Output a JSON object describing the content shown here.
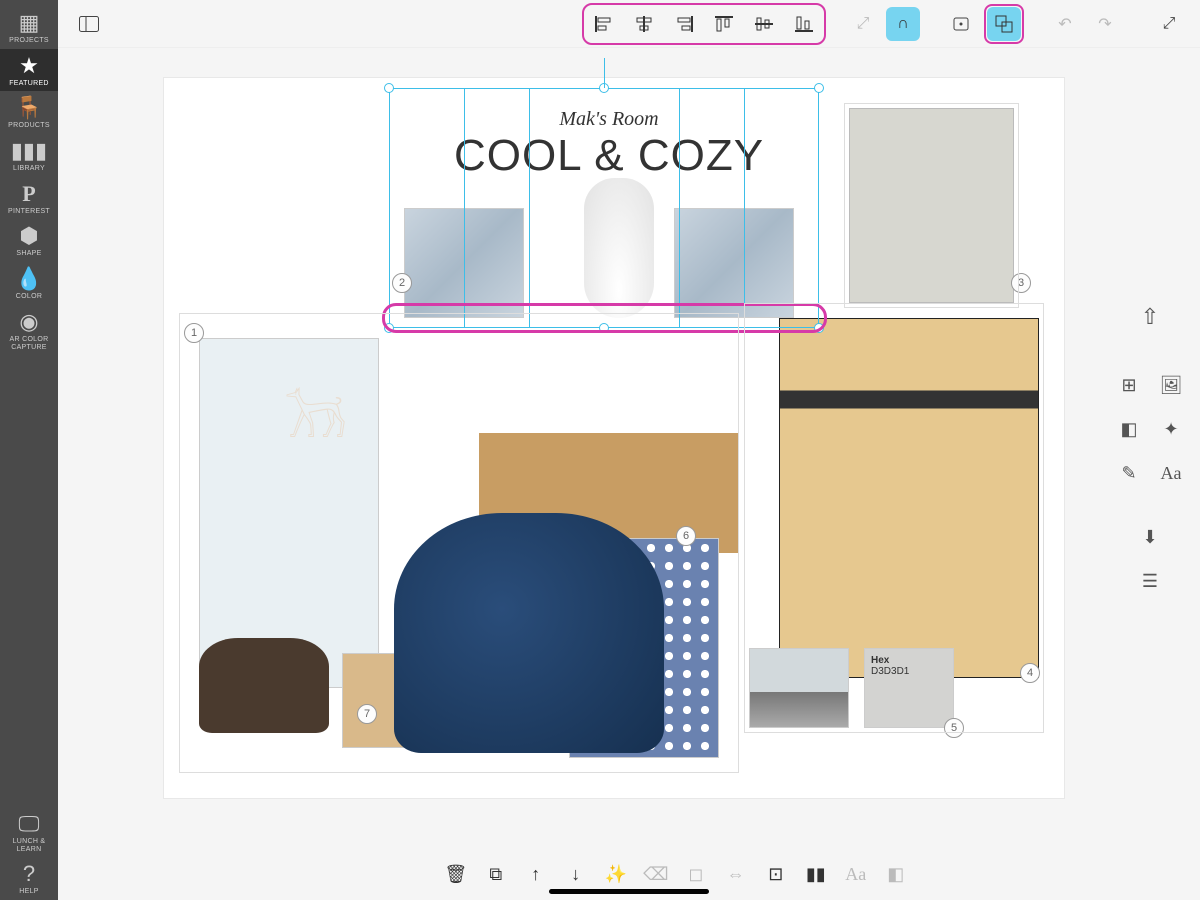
{
  "sidebar": {
    "items": [
      {
        "label": "PROJECTS",
        "icon": "grid"
      },
      {
        "label": "FEATURED",
        "icon": "star",
        "active": true
      },
      {
        "label": "PRODUCTS",
        "icon": "chair"
      },
      {
        "label": "LIBRARY",
        "icon": "books"
      },
      {
        "label": "PINTEREST",
        "icon": "pinterest"
      },
      {
        "label": "SHAPE",
        "icon": "cube"
      },
      {
        "label": "COLOR",
        "icon": "drop"
      },
      {
        "label": "AR COLOR CAPTURE",
        "icon": "aperture"
      }
    ],
    "bottom_items": [
      {
        "label": "LUNCH & LEARN",
        "icon": "tv"
      },
      {
        "label": "HELP",
        "icon": "question"
      }
    ]
  },
  "topbar": {
    "panel_toggle": "panel-toggle",
    "align_group": [
      {
        "name": "align-left-icon"
      },
      {
        "name": "align-hcenter-icon"
      },
      {
        "name": "align-right-icon"
      },
      {
        "name": "align-top-icon"
      },
      {
        "name": "align-vcenter-icon"
      },
      {
        "name": "align-bottom-icon"
      }
    ],
    "transform_lock": "lock",
    "snap": "snap",
    "lock": "lock",
    "multi_select": "multi-select",
    "undo": "undo",
    "redo": "redo",
    "fullscreen": "fullscreen"
  },
  "right_panel": {
    "share": "share",
    "tools": [
      [
        "grid",
        "image"
      ],
      [
        "swatches",
        "compass"
      ],
      [
        "pencil",
        "text"
      ]
    ],
    "import": "import",
    "layers": "layers"
  },
  "bottom_toolbar": [
    {
      "name": "trash-icon"
    },
    {
      "name": "copy-icon"
    },
    {
      "name": "bring-forward-icon"
    },
    {
      "name": "send-backward-icon"
    },
    {
      "name": "magic-wand-icon",
      "dim": true
    },
    {
      "name": "eraser-icon",
      "dim": true
    },
    {
      "name": "mask-icon",
      "dim": true
    },
    {
      "name": "flip-icon",
      "dim": true
    },
    {
      "name": "crop-icon"
    },
    {
      "name": "library-add-icon"
    },
    {
      "name": "text-style-icon",
      "dim": true
    },
    {
      "name": "swatch-add-icon",
      "dim": true
    }
  ],
  "board": {
    "subtitle": "Mak's Room",
    "headline": "COOL & COZY",
    "swatch_label": "Hex",
    "swatch_value": "D3D3D1",
    "markers": [
      "1",
      "2",
      "3",
      "4",
      "5",
      "6",
      "7"
    ]
  }
}
